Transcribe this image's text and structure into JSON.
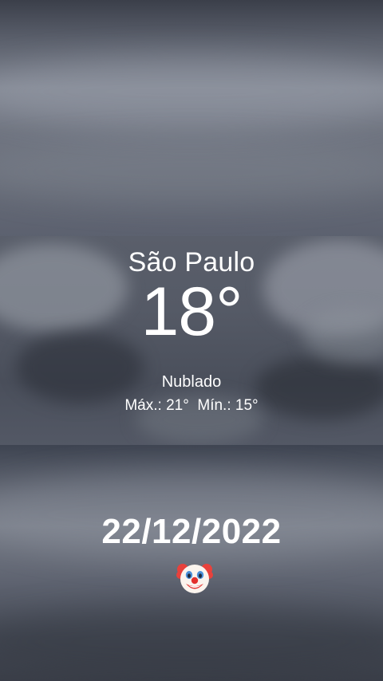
{
  "weather": {
    "city": "São Paulo",
    "temperature": "18°",
    "condition": "Nublado",
    "high_low": "Máx.: 21°  Mín.: 15°"
  },
  "caption": {
    "date": "22/12/2022",
    "emoji": "clown-face"
  },
  "colors": {
    "text": "#ffffff",
    "sky": "#5a5f6b"
  }
}
